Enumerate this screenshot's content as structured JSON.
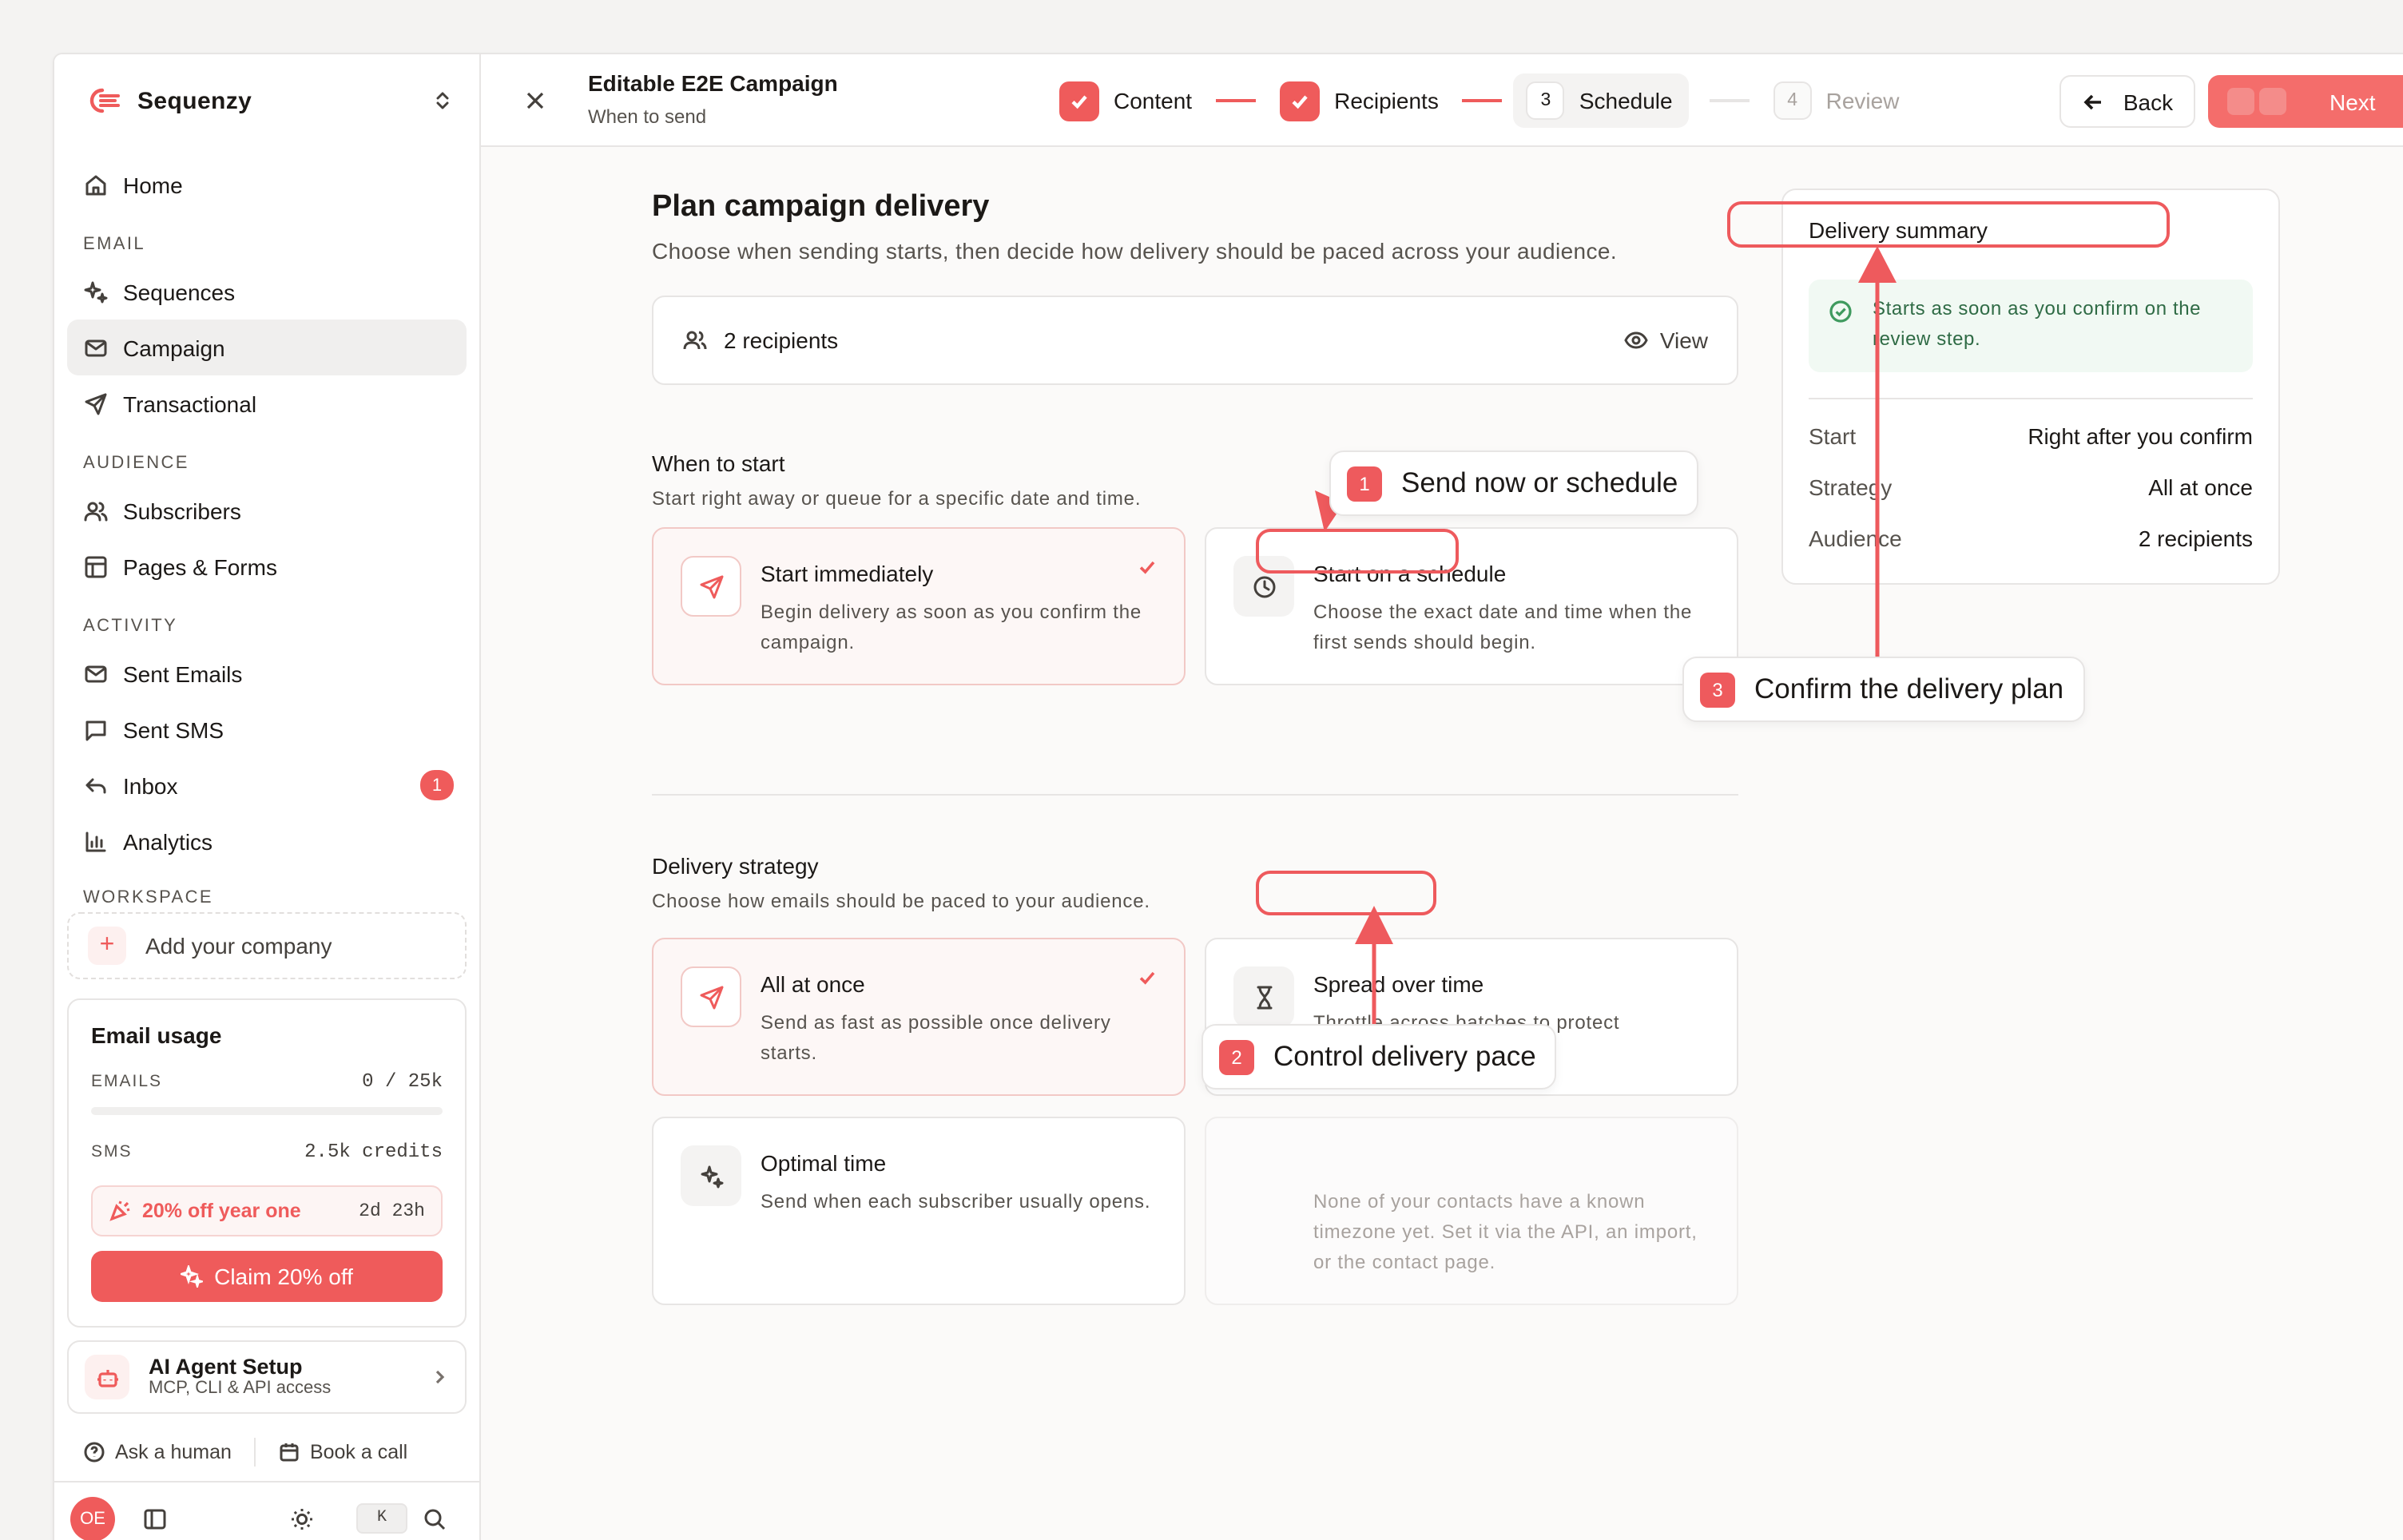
{
  "brand": {
    "name": "Sequenzy",
    "accent": "#ef5b5b"
  },
  "sidebar": {
    "home": "Home",
    "sections": {
      "email": "EMAIL",
      "audience": "AUDIENCE",
      "activity": "ACTIVITY",
      "workspace": "WORKSPACE"
    },
    "email_items": [
      "Sequences",
      "Campaign",
      "Transactional"
    ],
    "audience_items": [
      "Subscribers",
      "Pages & Forms"
    ],
    "activity_items": [
      "Sent Emails",
      "Sent SMS",
      "Inbox",
      "Analytics"
    ],
    "inbox_badge": "1",
    "add_company": "Add your company",
    "usage": {
      "title": "Email usage",
      "emails_label": "EMAILS",
      "emails_value": "0 / 25k",
      "emails_fraction": 0.0,
      "sms_label": "SMS",
      "sms_value": "2.5k credits",
      "promo_text": "20% off year one",
      "promo_timer": "2d 23h",
      "claim_label": "Claim 20% off"
    },
    "ai_setup": {
      "title": "AI Agent Setup",
      "subtitle": "MCP, CLI & API access"
    },
    "ask_human": "Ask a human",
    "book_call": "Book a call",
    "avatar_initials": "OE",
    "shortcut": "K"
  },
  "topbar": {
    "title": "Editable E2E Campaign",
    "subtitle": "When to send",
    "steps": [
      {
        "label": "Content",
        "state": "done"
      },
      {
        "label": "Recipients",
        "state": "done"
      },
      {
        "number": "3",
        "label": "Schedule",
        "state": "current"
      },
      {
        "number": "4",
        "label": "Review",
        "state": "future"
      }
    ],
    "back_label": "Back",
    "next_label": "Next"
  },
  "main": {
    "title": "Plan campaign delivery",
    "subtitle": "Choose when sending starts, then decide how delivery should be paced across your audience.",
    "recipients_label": "2 recipients",
    "view_label": "View",
    "when": {
      "title": "When to start",
      "subtitle": "Start right away or queue for a specific date and time.",
      "options": [
        {
          "title": "Start immediately",
          "desc": "Begin delivery as soon as you confirm the campaign.",
          "selected": true
        },
        {
          "title": "Start on a schedule",
          "desc": "Choose the exact date and time when the first sends should begin.",
          "selected": false
        }
      ]
    },
    "strategy": {
      "title": "Delivery strategy",
      "subtitle": "Choose how emails should be paced to your audience.",
      "options": [
        {
          "title": "All at once",
          "desc": "Send as fast as possible once delivery starts.",
          "selected": true
        },
        {
          "title": "Spread over time",
          "desc": "Throttle across batches to protect reputation.",
          "selected": false
        },
        {
          "title": "Optimal time",
          "desc": "Send when each subscriber usually opens.",
          "selected": false
        },
        {
          "title": "",
          "desc": "None of your contacts have a known timezone yet. Set it via the API, an import, or the contact page.",
          "selected": false,
          "disabled": true
        }
      ]
    }
  },
  "summary": {
    "title": "Delivery summary",
    "note": "Starts as soon as you confirm on the review step.",
    "rows": [
      {
        "key": "Start",
        "value": "Right after you confirm"
      },
      {
        "key": "Strategy",
        "value": "All at once"
      },
      {
        "key": "Audience",
        "value": "2 recipients"
      }
    ]
  },
  "annotations": [
    {
      "number": "1",
      "text": "Send now or schedule"
    },
    {
      "number": "2",
      "text": "Control delivery pace"
    },
    {
      "number": "3",
      "text": "Confirm the delivery plan"
    }
  ]
}
